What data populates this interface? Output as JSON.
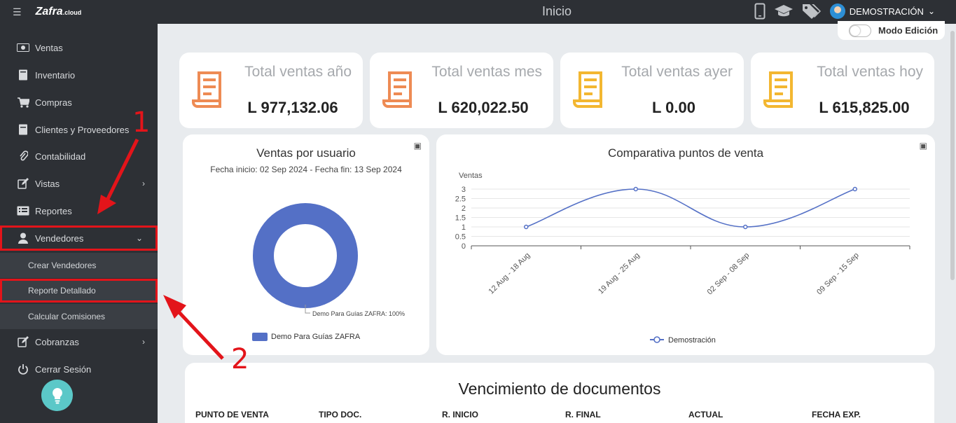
{
  "app": {
    "logo": "Zafra",
    "logo_suffix": ".cloud",
    "page_title": "Inicio"
  },
  "user": {
    "name": "DEMOSTRACIÓN"
  },
  "mode_toggle": {
    "label": "Modo Edición"
  },
  "sidebar": {
    "items": [
      {
        "label": "Ventas"
      },
      {
        "label": "Inventario"
      },
      {
        "label": "Compras"
      },
      {
        "label": "Clientes y Proveedores"
      },
      {
        "label": "Contabilidad"
      },
      {
        "label": "Vistas"
      },
      {
        "label": "Reportes"
      },
      {
        "label": "Vendedores"
      },
      {
        "label": "Cobranzas"
      },
      {
        "label": "Cerrar Sesión"
      }
    ],
    "subitems": [
      {
        "label": "Crear Vendedores"
      },
      {
        "label": "Reporte Detallado"
      },
      {
        "label": "Calcular Comisiones"
      }
    ]
  },
  "stats": [
    {
      "label": "Total ventas año",
      "value": "L 977,132.06",
      "color": "#ee8b54"
    },
    {
      "label": "Total ventas mes",
      "value": "L 620,022.50",
      "color": "#ee8b54"
    },
    {
      "label": "Total ventas ayer",
      "value": "L 0.00",
      "color": "#f3b731"
    },
    {
      "label": "Total ventas hoy",
      "value": "L 615,825.00",
      "color": "#f3b731"
    }
  ],
  "donut_panel": {
    "title": "Ventas por usuario",
    "subtitle": "Fecha inicio: 02 Sep 2024 - Fecha fin: 13 Sep 2024"
  },
  "line_panel": {
    "title": "Comparativa puntos de venta"
  },
  "chart_data": [
    {
      "type": "pie",
      "labels": [
        "Demo Para Guías ZAFRA"
      ],
      "values": [
        100
      ],
      "slice_label": "Demo Para Guías ZAFRA: 100%",
      "legend": [
        "Demo Para Guías ZAFRA"
      ],
      "color": "#5470c6"
    },
    {
      "type": "line",
      "categories": [
        "12 Aug - 18 Aug",
        "19 Aug - 25 Aug",
        "02 Sep - 08 Sep",
        "09 Sep - 15 Sep"
      ],
      "series": [
        {
          "name": "Demostración",
          "values": [
            1,
            3,
            1,
            3
          ]
        }
      ],
      "ylabel": "Ventas",
      "ylim": [
        0,
        3
      ],
      "yticks": [
        "0",
        "0.5",
        "1",
        "1.5",
        "2",
        "2.5",
        "3"
      ],
      "color": "#5470c6"
    }
  ],
  "documents": {
    "title": "Vencimiento de documentos",
    "columns": [
      "PUNTO DE VENTA",
      "TIPO DOC.",
      "R. INICIO",
      "R. FINAL",
      "ACTUAL",
      "FECHA EXP."
    ]
  },
  "annotations": {
    "one": "1",
    "two": "2",
    "color": "#e3141a"
  }
}
